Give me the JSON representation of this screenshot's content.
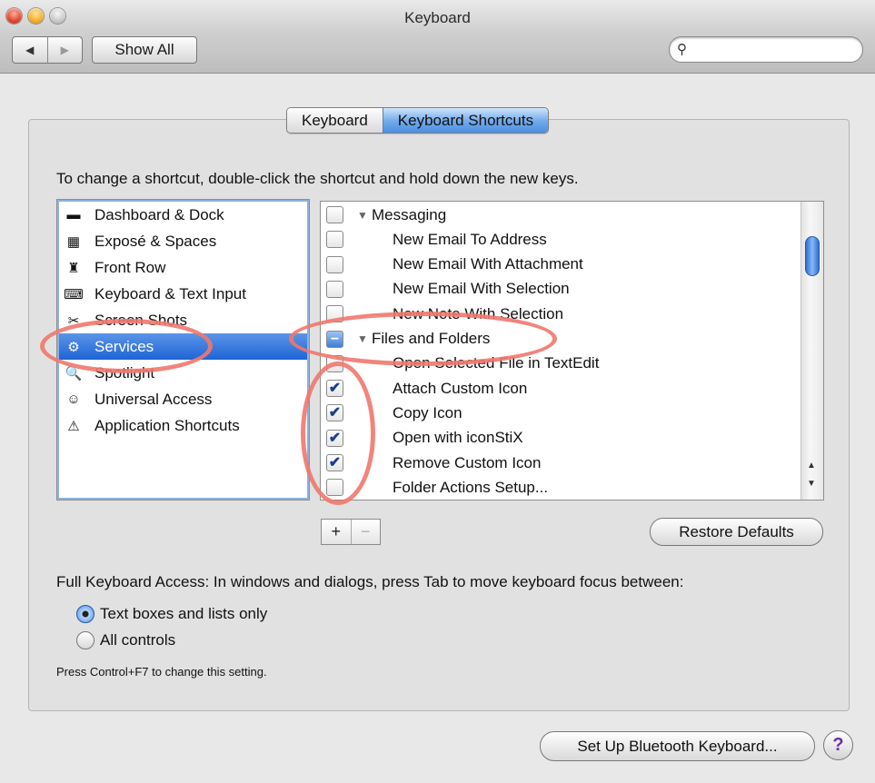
{
  "window": {
    "title": "Keyboard"
  },
  "toolbar": {
    "back_label": "◀",
    "forward_label": "▶",
    "show_all_label": "Show All",
    "search_placeholder": ""
  },
  "tabs": [
    {
      "label": "Keyboard"
    },
    {
      "label": "Keyboard Shortcuts",
      "selected": true
    }
  ],
  "instruction": "To change a shortcut, double-click the shortcut and hold down the new keys.",
  "categories": [
    {
      "label": "Dashboard & Dock",
      "icon": "dashboard-icon",
      "glyph": "▬"
    },
    {
      "label": "Exposé & Spaces",
      "icon": "expose-icon",
      "glyph": "▦"
    },
    {
      "label": "Front Row",
      "icon": "front-row-icon",
      "glyph": "♜"
    },
    {
      "label": "Keyboard & Text Input",
      "icon": "keyboard-icon",
      "glyph": "⌨"
    },
    {
      "label": "Screen Shots",
      "icon": "camera-icon",
      "glyph": "✂"
    },
    {
      "label": "Services",
      "icon": "gear-icon",
      "glyph": "⚙",
      "selected": true
    },
    {
      "label": "Spotlight",
      "icon": "spotlight-icon",
      "glyph": "🔍"
    },
    {
      "label": "Universal Access",
      "icon": "accessibility-icon",
      "glyph": "☺"
    },
    {
      "label": "Application Shortcuts",
      "icon": "app-shortcuts-icon",
      "glyph": "⚠"
    }
  ],
  "services": [
    {
      "label": "Messaging",
      "group": true,
      "checked": false
    },
    {
      "label": "New Email To Address",
      "checked": false
    },
    {
      "label": "New Email With Attachment",
      "checked": false
    },
    {
      "label": "New Email With Selection",
      "checked": false
    },
    {
      "label": "New Note With Selection",
      "checked": false
    },
    {
      "label": "Files and Folders",
      "group": true,
      "mixed": true
    },
    {
      "label": "Open Selected File in TextEdit",
      "checked": false
    },
    {
      "label": "Attach Custom Icon",
      "checked": true
    },
    {
      "label": "Copy Icon",
      "checked": true
    },
    {
      "label": "Open with iconStiX",
      "checked": true
    },
    {
      "label": "Remove Custom Icon",
      "checked": true
    },
    {
      "label": "Folder Actions Setup...",
      "checked": false
    }
  ],
  "list_controls": {
    "add_label": "+",
    "remove_label": "−"
  },
  "restore_defaults_label": "Restore Defaults",
  "full_keyboard_access": {
    "label": "Full Keyboard Access: In windows and dialogs, press Tab to move keyboard focus between:",
    "options": [
      {
        "label": "Text boxes and lists only",
        "selected": true
      },
      {
        "label": "All controls",
        "selected": false
      }
    ],
    "note": "Press Control+F7 to change this setting."
  },
  "bluetooth_button_label": "Set Up Bluetooth Keyboard...",
  "help_label": "?"
}
